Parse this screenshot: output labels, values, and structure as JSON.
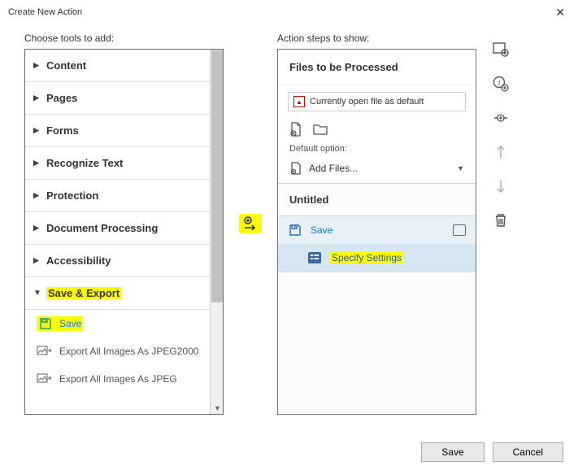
{
  "window": {
    "title": "Create New Action"
  },
  "left": {
    "label": "Choose tools to add:",
    "cats": [
      {
        "label": "Content",
        "expanded": false
      },
      {
        "label": "Pages",
        "expanded": false
      },
      {
        "label": "Forms",
        "expanded": false
      },
      {
        "label": "Recognize Text",
        "expanded": false
      },
      {
        "label": "Protection",
        "expanded": false
      },
      {
        "label": "Document Processing",
        "expanded": false
      },
      {
        "label": "Accessibility",
        "expanded": false
      },
      {
        "label": "Save & Export",
        "expanded": true
      }
    ],
    "tools": [
      {
        "label": "Save",
        "highlighted": true
      },
      {
        "label": "Export All Images As JPEG2000",
        "highlighted": false
      },
      {
        "label": "Export All Images As JPEG",
        "highlighted": false
      }
    ]
  },
  "right": {
    "label": "Action steps to show:",
    "files_title": "Files to be Processed",
    "default_text": "Currently open file as default",
    "default_option_label": "Default option:",
    "add_files_label": "Add Files...",
    "untitled": "Untitled",
    "step_save": "Save",
    "step_specify": "Specify Settings"
  },
  "buttons": {
    "save": "Save",
    "cancel": "Cancel"
  }
}
